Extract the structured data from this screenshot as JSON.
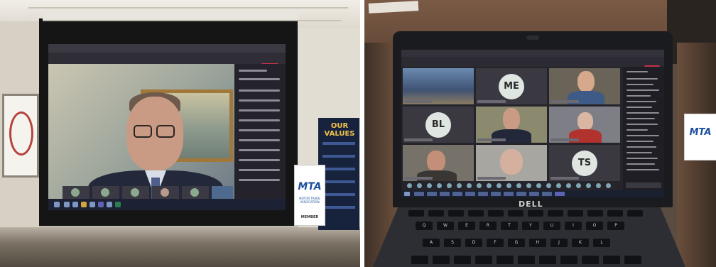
{
  "left_photo": {
    "banner": {
      "title_line1": "OUR",
      "title_line2": "VALUES"
    },
    "mta_sign": {
      "logo": "MTA",
      "subtitle": "MOTOR TRADE ASSOCIATION",
      "member": "MEMBER"
    },
    "colors": {
      "leave_button": "#c4314b",
      "banner_bg": "#17223d",
      "banner_text": "#f1c34a",
      "mta_blue": "#1d4f9d"
    }
  },
  "right_photo": {
    "participants_initials": [
      "ME",
      "BL",
      "TS"
    ],
    "laptop_brand": "DELL",
    "mta_sign": {
      "logo": "MTA"
    },
    "keyboard_keys": [
      "Q",
      "W",
      "E",
      "R",
      "T",
      "Y",
      "U",
      "I",
      "O",
      "P",
      "A",
      "S",
      "D",
      "F",
      "G",
      "H",
      "J",
      "K",
      "L"
    ],
    "colors": {
      "leave_button": "#c4314b",
      "avatar_bg": "#dfe6e2",
      "taskbar": "#1a2030"
    }
  }
}
